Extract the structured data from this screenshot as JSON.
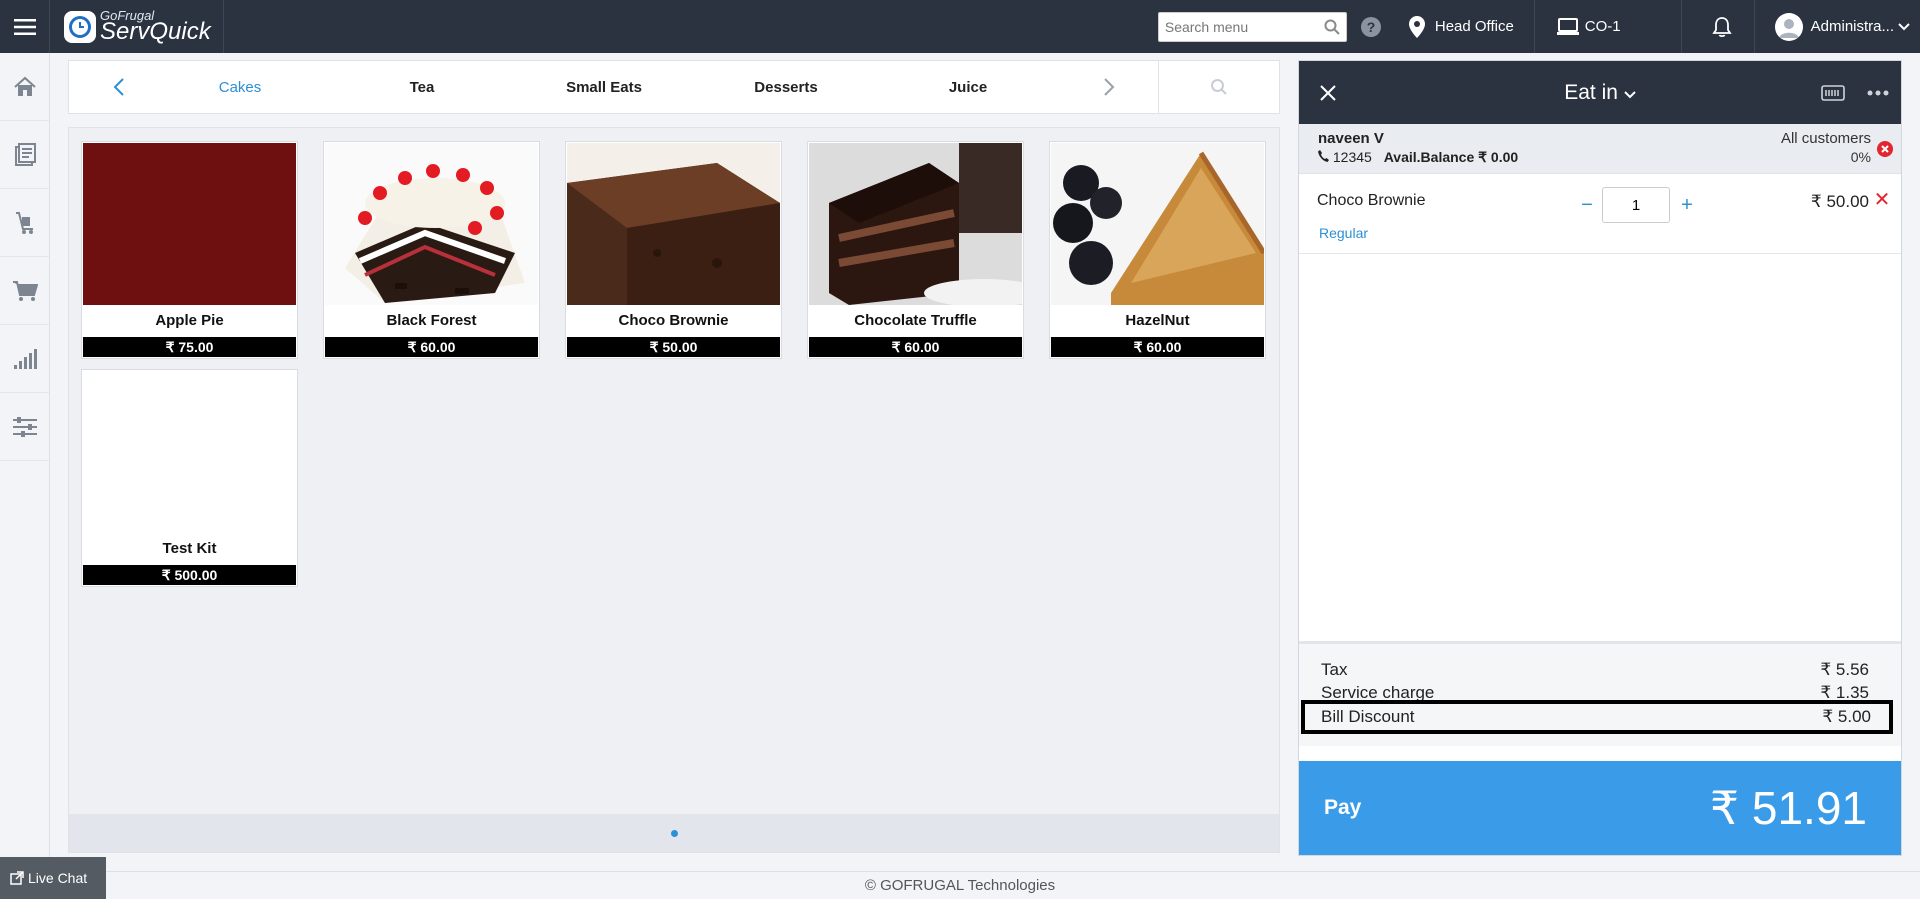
{
  "app": {
    "brand_small": "GoFrugal",
    "brand_big": "ServQuick"
  },
  "topbar": {
    "search_placeholder": "Search menu",
    "location": "Head Office",
    "counter": "CO-1",
    "user": "Administra..."
  },
  "categories": {
    "tabs": [
      "Cakes",
      "Tea",
      "Small Eats",
      "Desserts",
      "Juice"
    ],
    "active": "Cakes"
  },
  "items": [
    {
      "name": "Apple Pie",
      "price": "₹ 75.00"
    },
    {
      "name": "Black Forest",
      "price": "₹ 60.00"
    },
    {
      "name": "Choco Brownie",
      "price": "₹ 50.00"
    },
    {
      "name": "Chocolate Truffle",
      "price": "₹ 60.00"
    },
    {
      "name": "HazelNut",
      "price": "₹ 60.00"
    },
    {
      "name": "Test Kit",
      "price": "₹ 500.00"
    }
  ],
  "order": {
    "mode": "Eat in",
    "customer": {
      "name": "naveen V",
      "phone": "12345",
      "balance": "Avail.Balance ₹ 0.00",
      "group": "All customers",
      "discount": "0%"
    },
    "lines": [
      {
        "name": "Choco Brownie",
        "variant": "Regular",
        "qty": "1",
        "price": "₹ 50.00"
      }
    ],
    "totals": {
      "tax_label": "Tax",
      "tax": "₹ 5.56",
      "service_label": "Service charge",
      "service": "₹ 1.35",
      "discount_label": "Bill Discount",
      "discount": "₹ 5.00"
    },
    "pay_label": "Pay",
    "pay_amount": "₹ 51.91"
  },
  "footer": {
    "copyright": "© GOFRUGAL Technologies",
    "livechat": "Live Chat"
  },
  "colors": {
    "topbar": "#2b3340",
    "accent": "#2d8fd6",
    "pay": "#3a9ce8",
    "danger": "#e0262f"
  }
}
